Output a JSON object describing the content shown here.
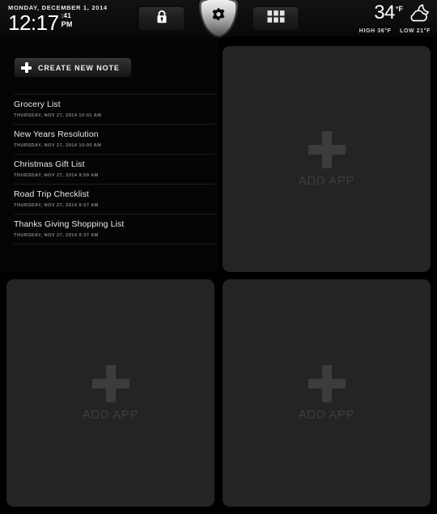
{
  "topbar": {
    "date": "MONDAY, DECEMBER 1, 2014",
    "time": "12:17",
    "seconds": ":41",
    "ampm": "PM",
    "controls": {
      "lock_icon": "lock-icon",
      "settings_icon": "gear-icon",
      "apps_grid_icon": "grid-icon"
    },
    "weather": {
      "temp": "34",
      "unit": "°F",
      "condition_icon": "moon-cloud-icon",
      "high": "HIGH 36°F",
      "low": "LOW 21°F"
    }
  },
  "notes": {
    "create_button_label": "CREATE NEW NOTE",
    "create_button_icon": "plus-icon",
    "list_view_icon": "list-view-icon",
    "items": [
      {
        "title": "Grocery List",
        "time": "THURSDAY, NOV 27, 2014 10:01 AM"
      },
      {
        "title": "New Years Resolution",
        "time": "THURSDAY, NOV 27, 2014 10:00 AM"
      },
      {
        "title": "Christmas Gift List",
        "time": "THURSDAY, NOV 27, 2014 9:59 AM"
      },
      {
        "title": "Road Trip Checklist",
        "time": "THURSDAY, NOV 27, 2014 9:57 AM"
      },
      {
        "title": "Thanks Giving Shopping List",
        "time": "THURSDAY, NOV 27, 2014 9:37 AM"
      }
    ]
  },
  "app_panels": [
    {
      "label": "ADD APP",
      "icon": "plus-icon"
    },
    {
      "label": "ADD APP",
      "icon": "plus-icon"
    },
    {
      "label": "ADD APP",
      "icon": "plus-icon"
    }
  ],
  "colors": {
    "background": "#000000",
    "panel": "#242424",
    "notes_panel": "#050505",
    "text_primary": "#eaeaea",
    "text_muted": "#838383",
    "addapp_text": "#3d3d3d"
  }
}
